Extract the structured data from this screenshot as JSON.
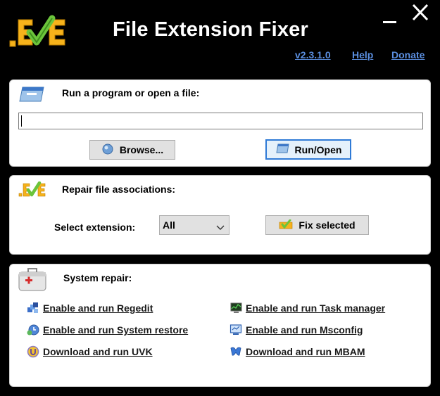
{
  "header": {
    "title": "File Extension Fixer",
    "logo_text": ".EXE",
    "version": "v2.3.1.0",
    "help": "Help",
    "donate": "Donate",
    "link_color": "#5b8fe0",
    "logo_color": "#f6b21b",
    "check_color": "#6cc43b"
  },
  "window": {
    "minimize_icon": "minimize-icon",
    "close_icon": "close-icon"
  },
  "run_section": {
    "title": "Run a program or open a file:",
    "input_value": "",
    "browse_label": "Browse...",
    "run_label": "Run/Open"
  },
  "repair_section": {
    "title": "Repair file associations:",
    "select_label": "Select extension:",
    "select_value": "All",
    "fix_label": "Fix selected"
  },
  "system_section": {
    "title": "System repair:",
    "links": [
      {
        "label": "Enable and run Regedit",
        "icon": "regedit-icon"
      },
      {
        "label": "Enable and run System restore",
        "icon": "system-restore-icon"
      },
      {
        "label": "Download and run UVK",
        "icon": "uvk-icon"
      },
      {
        "label": "Enable and run Task manager",
        "icon": "task-manager-icon"
      },
      {
        "label": "Enable and run Msconfig",
        "icon": "msconfig-icon"
      },
      {
        "label": "Download and run MBAM",
        "icon": "mbam-icon"
      }
    ]
  },
  "colors": {
    "accent": "#2f7ad6",
    "panel_border": "#cfcfcf",
    "background": "#000000"
  }
}
